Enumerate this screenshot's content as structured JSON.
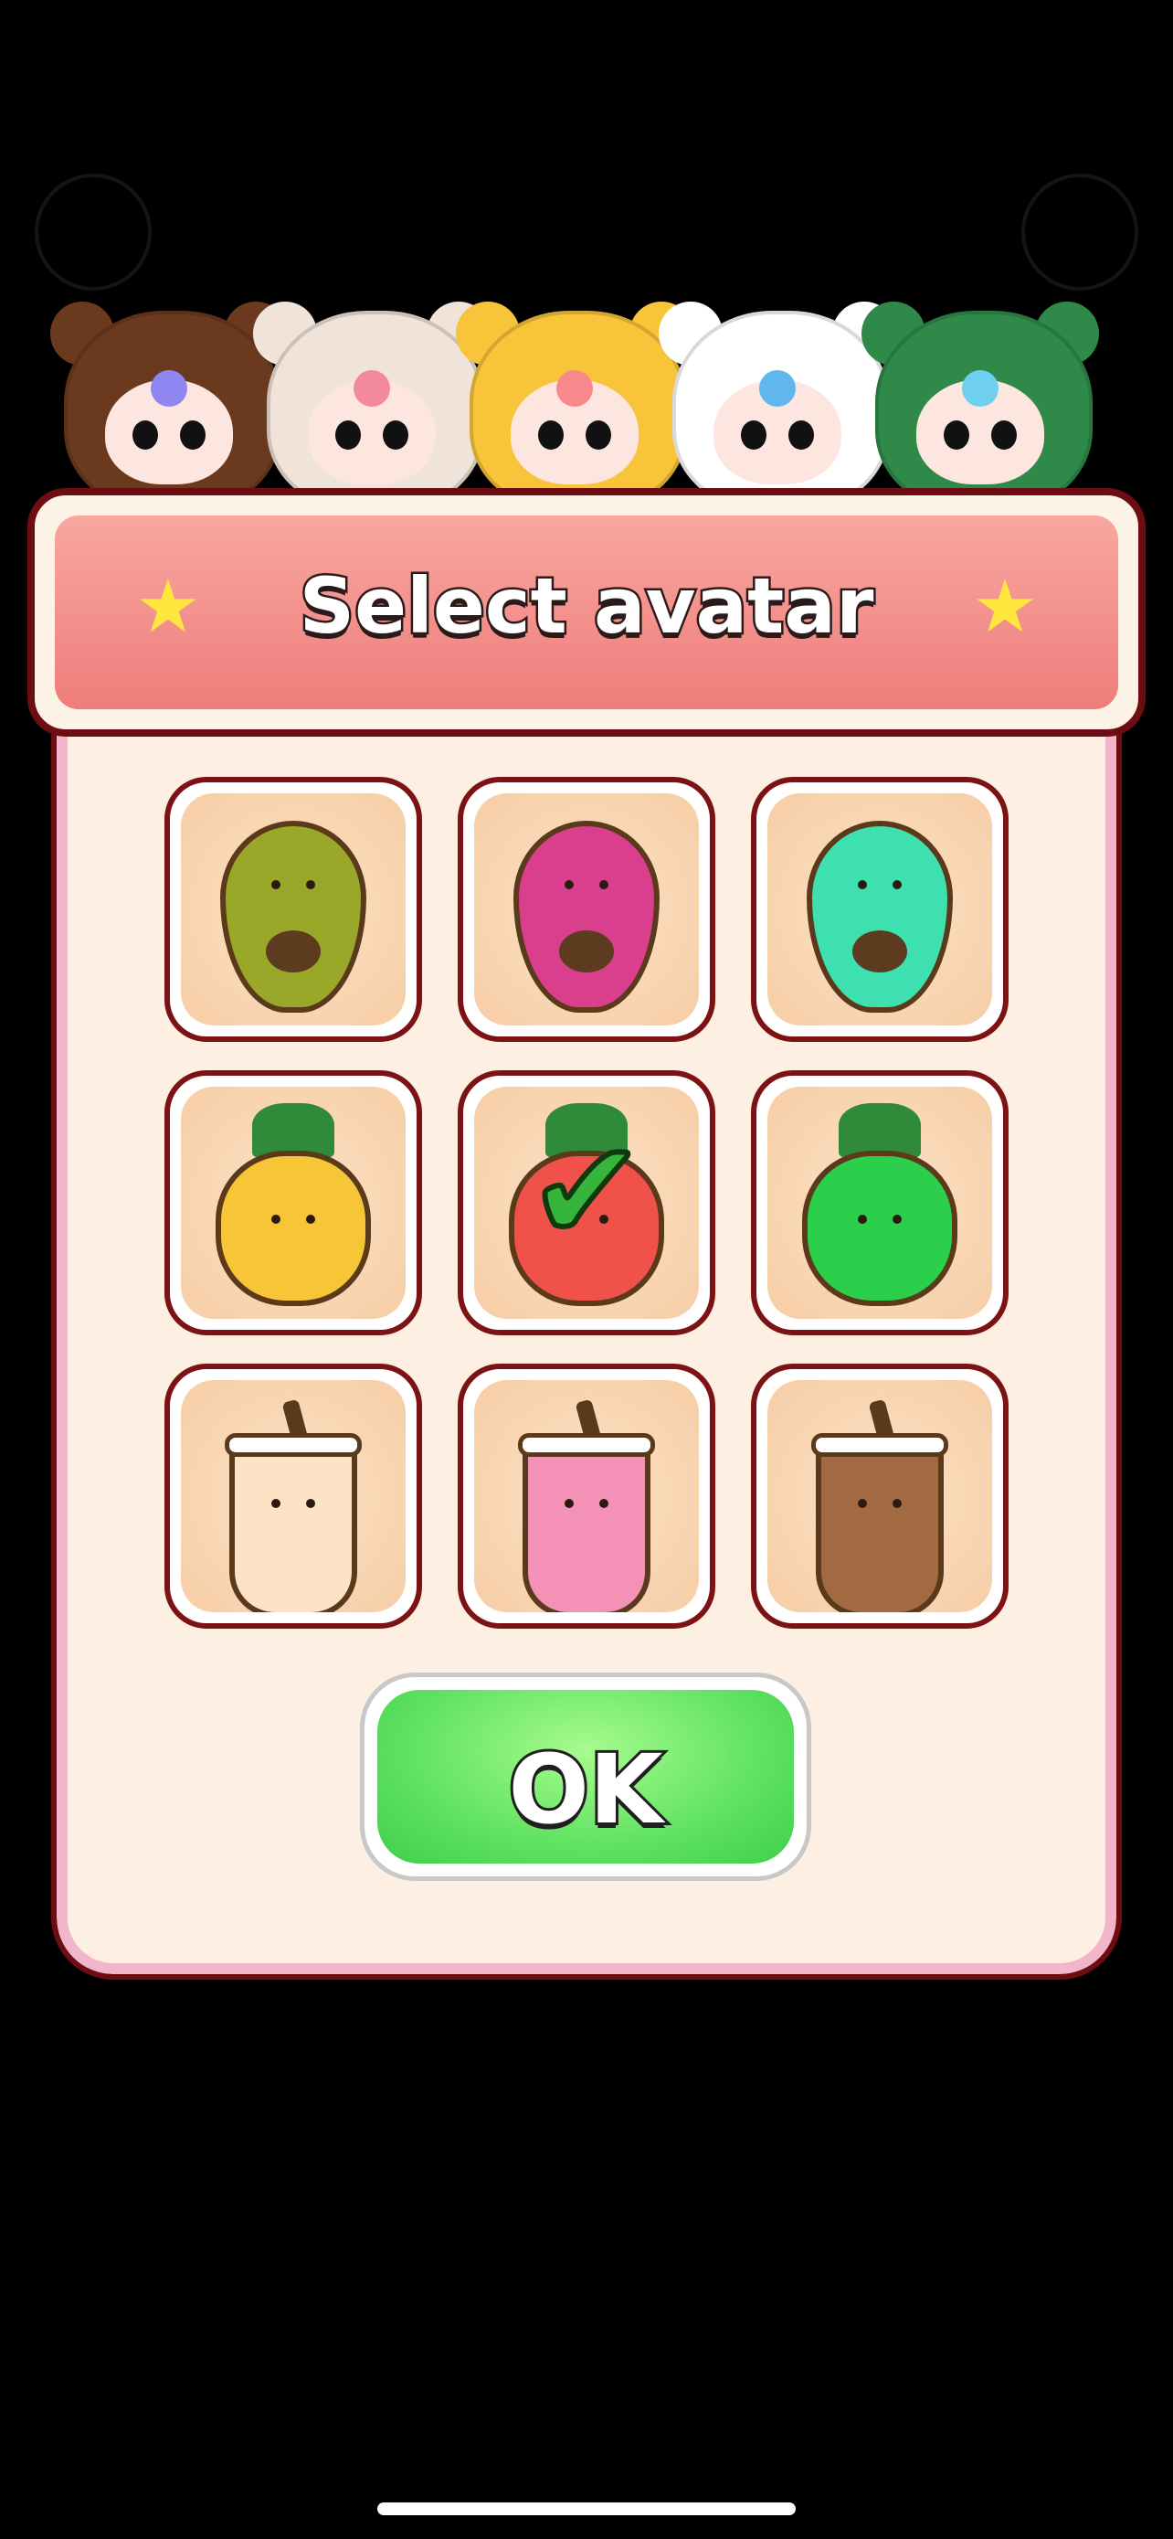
{
  "dialog": {
    "title": "Select avatar",
    "ok_label": "OK"
  },
  "mascots": [
    {
      "name": "monkey",
      "hood_color": "#6b3a1e",
      "gem_color": "#8f86f2"
    },
    {
      "name": "cow",
      "hood_color": "#efe3da",
      "gem_color": "#f3899e"
    },
    {
      "name": "chicken",
      "hood_color": "#f8c43a",
      "gem_color": "#f7888b"
    },
    {
      "name": "panda",
      "hood_color": "#ffffff",
      "gem_color": "#60b7ee"
    },
    {
      "name": "dinosaur",
      "hood_color": "#2f8a4a",
      "gem_color": "#6fcfee"
    }
  ],
  "avatars": [
    {
      "id": "avocado-green",
      "type": "avocado",
      "color": "#9aa82a",
      "selected": false
    },
    {
      "id": "avocado-pink",
      "type": "avocado",
      "color": "#d93f8c",
      "selected": false
    },
    {
      "id": "avocado-teal",
      "type": "avocado",
      "color": "#3fe0b0",
      "selected": false
    },
    {
      "id": "pineapple-yellow",
      "type": "pineapple",
      "color": "#f7c637",
      "selected": false
    },
    {
      "id": "pineapple-red",
      "type": "pineapple",
      "color": "#f0524a",
      "selected": true
    },
    {
      "id": "pineapple-green",
      "type": "pineapple",
      "color": "#2ccf4c",
      "selected": false
    },
    {
      "id": "boba-cream",
      "type": "boba",
      "color": "#fde2c6",
      "selected": false
    },
    {
      "id": "boba-pink",
      "type": "boba",
      "color": "#f491b7",
      "selected": false
    },
    {
      "id": "boba-brown",
      "type": "boba",
      "color": "#a26a42",
      "selected": false
    }
  ],
  "colors": {
    "accent_header": "#ee7d7b",
    "frame_border": "#6d0d12",
    "panel_bg": "#fdf0e2",
    "ok_green": "#5fe261"
  }
}
